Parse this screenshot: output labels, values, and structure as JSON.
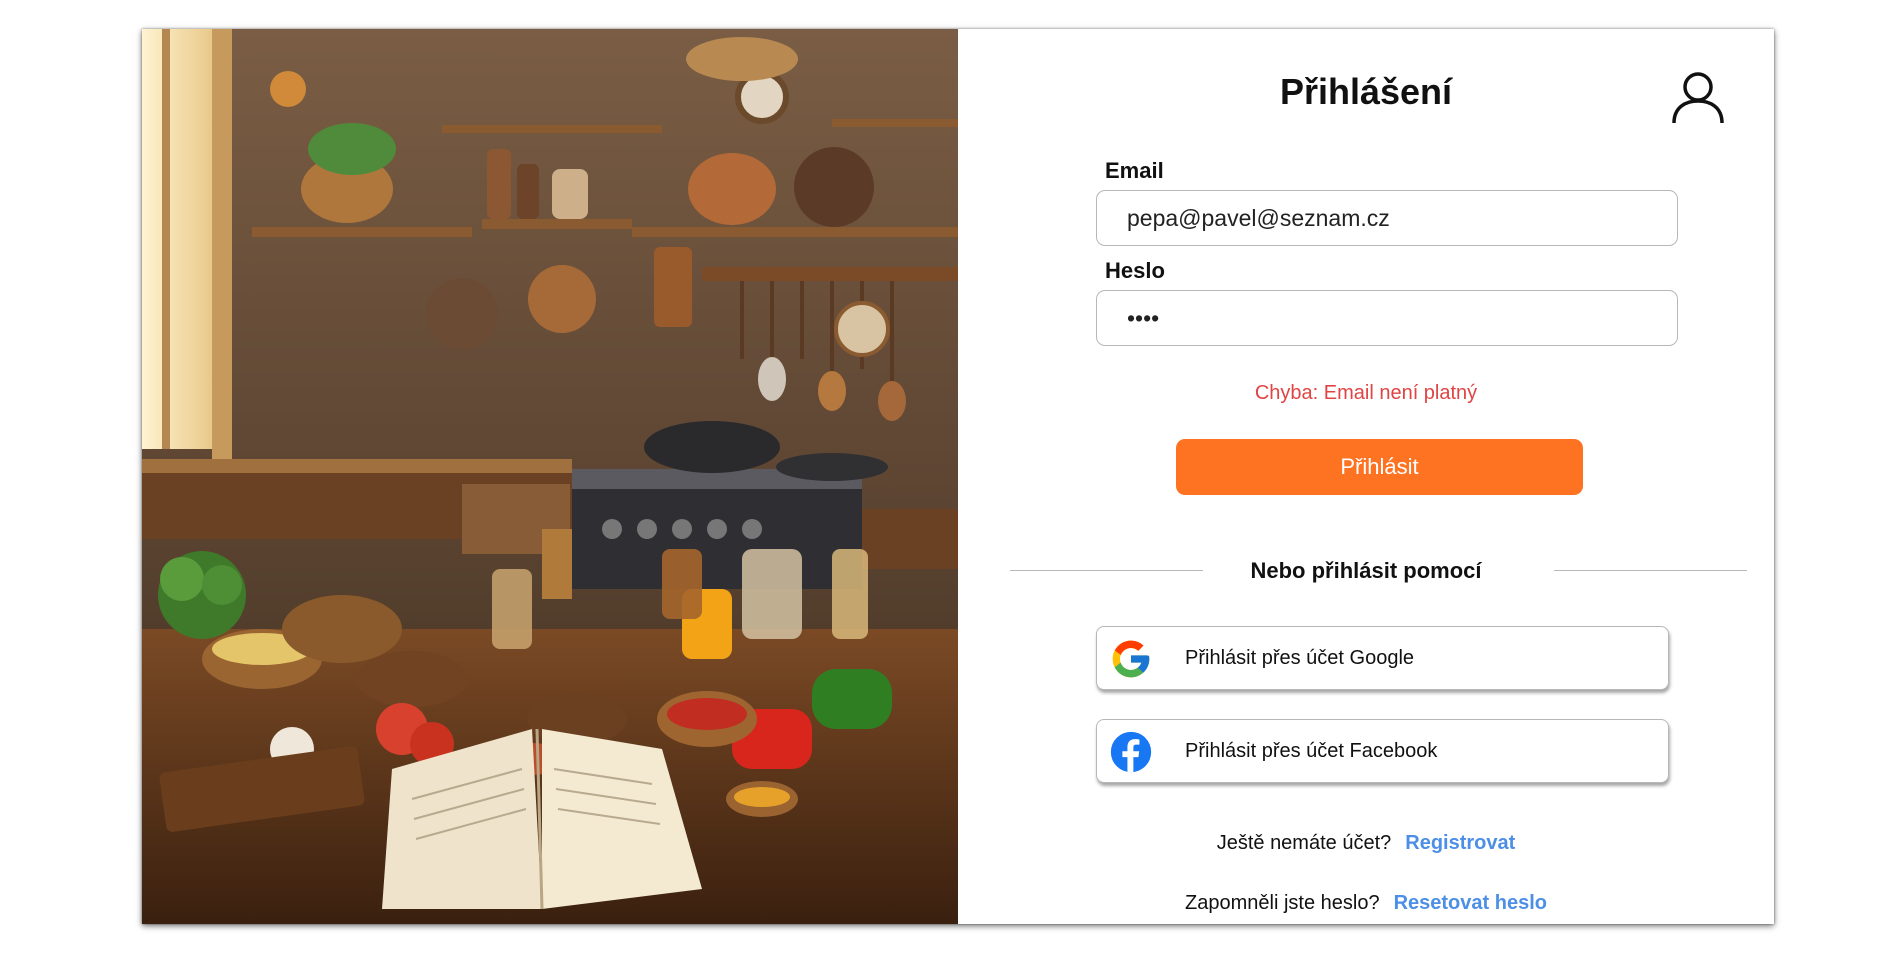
{
  "login": {
    "title": "Přihlášení",
    "email_label": "Email",
    "email_value": "pepa@pavel@seznam.cz",
    "password_label": "Heslo",
    "password_value": "••••",
    "error_text": "Chyba: Email není platný",
    "submit_label": "Přihlásit",
    "divider_text": "Nebo přihlásit pomocí",
    "google_label": "Přihlásit přes účet Google",
    "facebook_label": "Přihlásit přes účet Facebook",
    "register_prompt": "Ještě nemáte účet?",
    "register_link": "Registrovat",
    "forgot_prompt": "Zapomněli jste heslo?",
    "reset_link": "Resetovat heslo"
  },
  "icons": {
    "user": "user-icon",
    "google": "google-icon",
    "facebook": "facebook-icon"
  },
  "colors": {
    "accent": "#fd7322",
    "error": "#e04444",
    "link": "#4d8fe6",
    "facebook": "#1877f2"
  }
}
